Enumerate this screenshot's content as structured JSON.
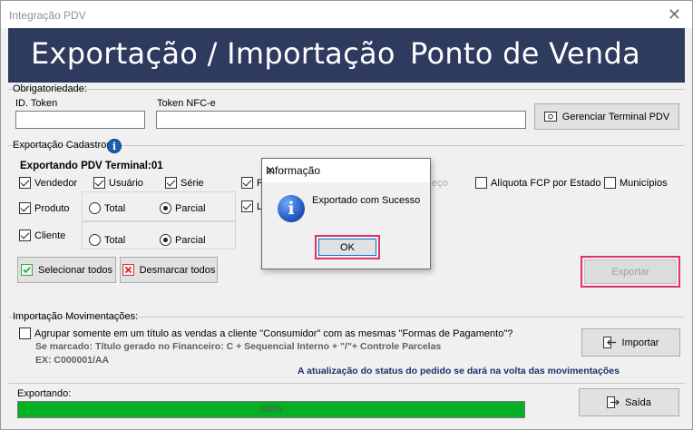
{
  "window": {
    "title": "Integração PDV",
    "close_glyph": "✕"
  },
  "banner": {
    "left_text": "Exportação / Importação",
    "right_text": "Ponto de Venda"
  },
  "obrigatoriedade": {
    "label": "Obrigatoriedade:",
    "id_token_label": "ID. Token",
    "id_token_value": "",
    "token_nfce_label": "Token NFC-e",
    "token_nfce_value": "",
    "gerenciar_button": "Gerenciar Terminal PDV",
    "gerenciar_icon": "terminal-icon"
  },
  "exportacao": {
    "label": "Exportação Cadastros:",
    "terminal_label": "Exportando PDV Terminal:01",
    "checkboxes": {
      "vendedor": {
        "label": "Vendedor",
        "checked": true
      },
      "usuario": {
        "label": "Usuário",
        "checked": true
      },
      "serie": {
        "label": "Série",
        "checked": true
      },
      "fourth": {
        "label": "F",
        "checked": true
      },
      "fifth": {
        "label": "L",
        "checked": true
      },
      "aliquota": {
        "label": "Alíquota FCP por Estado",
        "checked": false
      },
      "municipios": {
        "label": "Municípios",
        "checked": false
      },
      "produto": {
        "label": "Produto",
        "checked": true
      },
      "cliente": {
        "label": "Cliente",
        "checked": true
      }
    },
    "hidden_partial_label": "eço",
    "produto_options": {
      "total": "Total",
      "parcial": "Parcial",
      "selected": "parcial"
    },
    "cliente_options": {
      "total": "Total",
      "parcial": "Parcial",
      "selected": "parcial"
    },
    "selecionar_todos": "Selecionar todos",
    "desmarcar_todos": "Desmarcar todos",
    "exportar": "Exportar"
  },
  "importacao": {
    "label": "Importação Movimentações:",
    "agrupar_label": "Agrupar somente em um título as vendas a cliente \"Consumidor\" com as mesmas \"Formas de Pagamento\"?",
    "agrupar_checked": false,
    "hint_line1": "Se marcado: Título gerado no Financeiro: C + Sequencial Interno + \"/\"+ Controle Parcelas",
    "hint_line2": "EX: C000001/AA",
    "status_note": "A atualização do status do pedido se dará na volta das movimentações",
    "importar": "Importar"
  },
  "footer": {
    "exportando_label": "Exportando:",
    "progress_percent": 100,
    "progress_text": "100%",
    "saida": "Saída"
  },
  "dialog": {
    "title": "Informação",
    "message": "Exportado com Sucesso",
    "ok": "OK",
    "close_glyph": "✕"
  },
  "colors": {
    "banner": "#2e3a5e",
    "progress": "#06b025",
    "highlight": "#e0306f"
  }
}
